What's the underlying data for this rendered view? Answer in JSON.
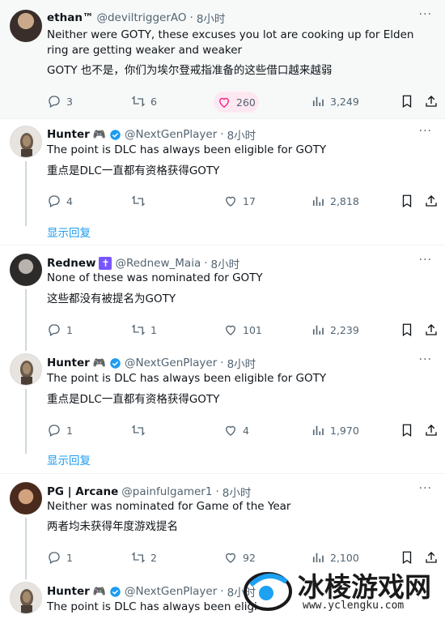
{
  "tweets": [
    {
      "name": "ethan™",
      "handle": "@deviltriggerAO",
      "time": "8小时",
      "lines": [
        "Neither were GOTY, these excuses you lot are cooking up for Elden ring are getting weaker and weaker"
      ],
      "translation": "GOTY 也不是，你们为埃尔登戒指准备的这些借口越来越弱",
      "reply": "3",
      "retweet": "6",
      "like": "260",
      "views": "3,249"
    },
    {
      "name": "Hunter",
      "handle": "@NextGenPlayer",
      "time": "8小时",
      "lines": [
        "The point is DLC has always been eligible for GOTY"
      ],
      "translation": "重点是DLC一直都有资格获得GOTY",
      "reply": "4",
      "retweet": "",
      "like": "17",
      "views": "2,818"
    },
    {
      "name": "Rednew",
      "handle": "@Rednew_Maia",
      "time": "8小时",
      "lines": [
        "None of these was nominated for GOTY"
      ],
      "translation": "这些都没有被提名为GOTY",
      "reply": "1",
      "retweet": "1",
      "like": "101",
      "views": "2,239"
    },
    {
      "name": "Hunter",
      "handle": "@NextGenPlayer",
      "time": "8小时",
      "lines": [
        "The point is DLC has always been eligible for GOTY"
      ],
      "translation": "重点是DLC一直都有资格获得GOTY",
      "reply": "1",
      "retweet": "",
      "like": "4",
      "views": "1,970"
    },
    {
      "name": "PG | Arcane",
      "handle": "@painfulgamer1",
      "time": "8小时",
      "lines": [
        "Neither was nominated for Game of the Year"
      ],
      "translation": "两者均未获得年度游戏提名",
      "reply": "1",
      "retweet": "2",
      "like": "92",
      "views": "2,100"
    },
    {
      "name": "Hunter",
      "handle": "@NextGenPlayer",
      "time": "8小时",
      "lines": [
        "The point is DLC has always been eligi"
      ]
    }
  ],
  "show_replies_label": "显示回复",
  "dot": "·",
  "more": "···",
  "watermark": {
    "text": "冰棱游戏网",
    "url": "www.yclengku.com"
  },
  "colors": {
    "accent": "#1d9bf0",
    "muted": "#536471",
    "like": "#f91880",
    "verified": "#1d9bf0"
  }
}
